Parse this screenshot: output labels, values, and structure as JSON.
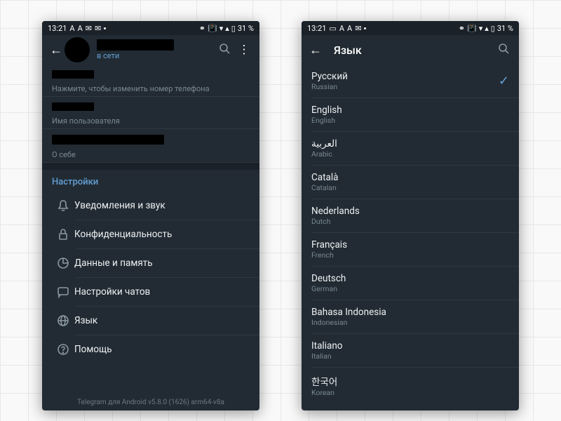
{
  "status": {
    "time": "13:21",
    "battery": "31 %"
  },
  "screen1": {
    "subtitle": "в сети",
    "phone_hint": "Нажмите, чтобы изменить номер телефона",
    "username_label": "Имя пользователя",
    "about_label": "О себе",
    "settings_header": "Настройки",
    "rows": {
      "notifications": "Уведомления и звук",
      "privacy": "Конфиденциальность",
      "data": "Данные и память",
      "chats": "Настройки чатов",
      "language": "Язык",
      "help": "Помощь"
    },
    "version": "Telegram для Android v5.8.0 (1626) arm64-v8a"
  },
  "screen2": {
    "title": "Язык",
    "languages": [
      {
        "native": "Русский",
        "english": "Russian",
        "selected": true
      },
      {
        "native": "English",
        "english": "English",
        "selected": false
      },
      {
        "native": "العربية",
        "english": "Arabic",
        "selected": false
      },
      {
        "native": "Català",
        "english": "Catalan",
        "selected": false
      },
      {
        "native": "Nederlands",
        "english": "Dutch",
        "selected": false
      },
      {
        "native": "Français",
        "english": "French",
        "selected": false
      },
      {
        "native": "Deutsch",
        "english": "German",
        "selected": false
      },
      {
        "native": "Bahasa Indonesia",
        "english": "Indonesian",
        "selected": false
      },
      {
        "native": "Italiano",
        "english": "Italian",
        "selected": false
      },
      {
        "native": "한국어",
        "english": "Korean",
        "selected": false
      }
    ]
  }
}
